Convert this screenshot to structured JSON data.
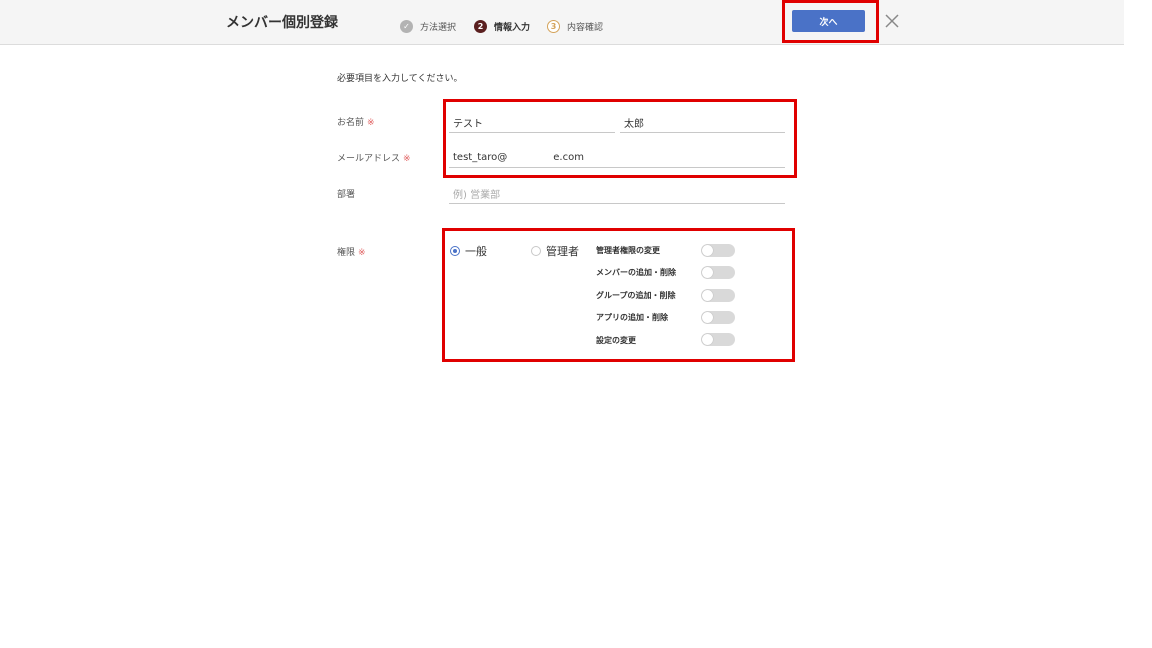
{
  "header": {
    "title": "メンバー個別登録",
    "steps": [
      {
        "num": "✓",
        "label": "方法選択"
      },
      {
        "num": "2",
        "label": "情報入力"
      },
      {
        "num": "3",
        "label": "内容確認"
      }
    ],
    "next_label": "次へ"
  },
  "form": {
    "instruction": "必要項目を入力してください。",
    "required_mark": "※",
    "name_label": "お名前",
    "last_name": "テスト",
    "first_name": "太郎",
    "email_label": "メールアドレス",
    "email_value": "test_taro@",
    "email_domain": "e.com",
    "dept_label": "部署",
    "dept_placeholder": "例) 営業部",
    "role_label": "権限",
    "role_general": "一般",
    "role_admin": "管理者",
    "role_selected": "一般",
    "permissions": [
      {
        "label": "管理者権限の変更",
        "enabled": false
      },
      {
        "label": "メンバーの追加・削除",
        "enabled": false
      },
      {
        "label": "グループの追加・削除",
        "enabled": false
      },
      {
        "label": "アプリの追加・削除",
        "enabled": false
      },
      {
        "label": "設定の変更",
        "enabled": false
      }
    ]
  },
  "colors": {
    "accent": "#4a72c7",
    "highlight": "#e00000",
    "required": "#e06060"
  }
}
